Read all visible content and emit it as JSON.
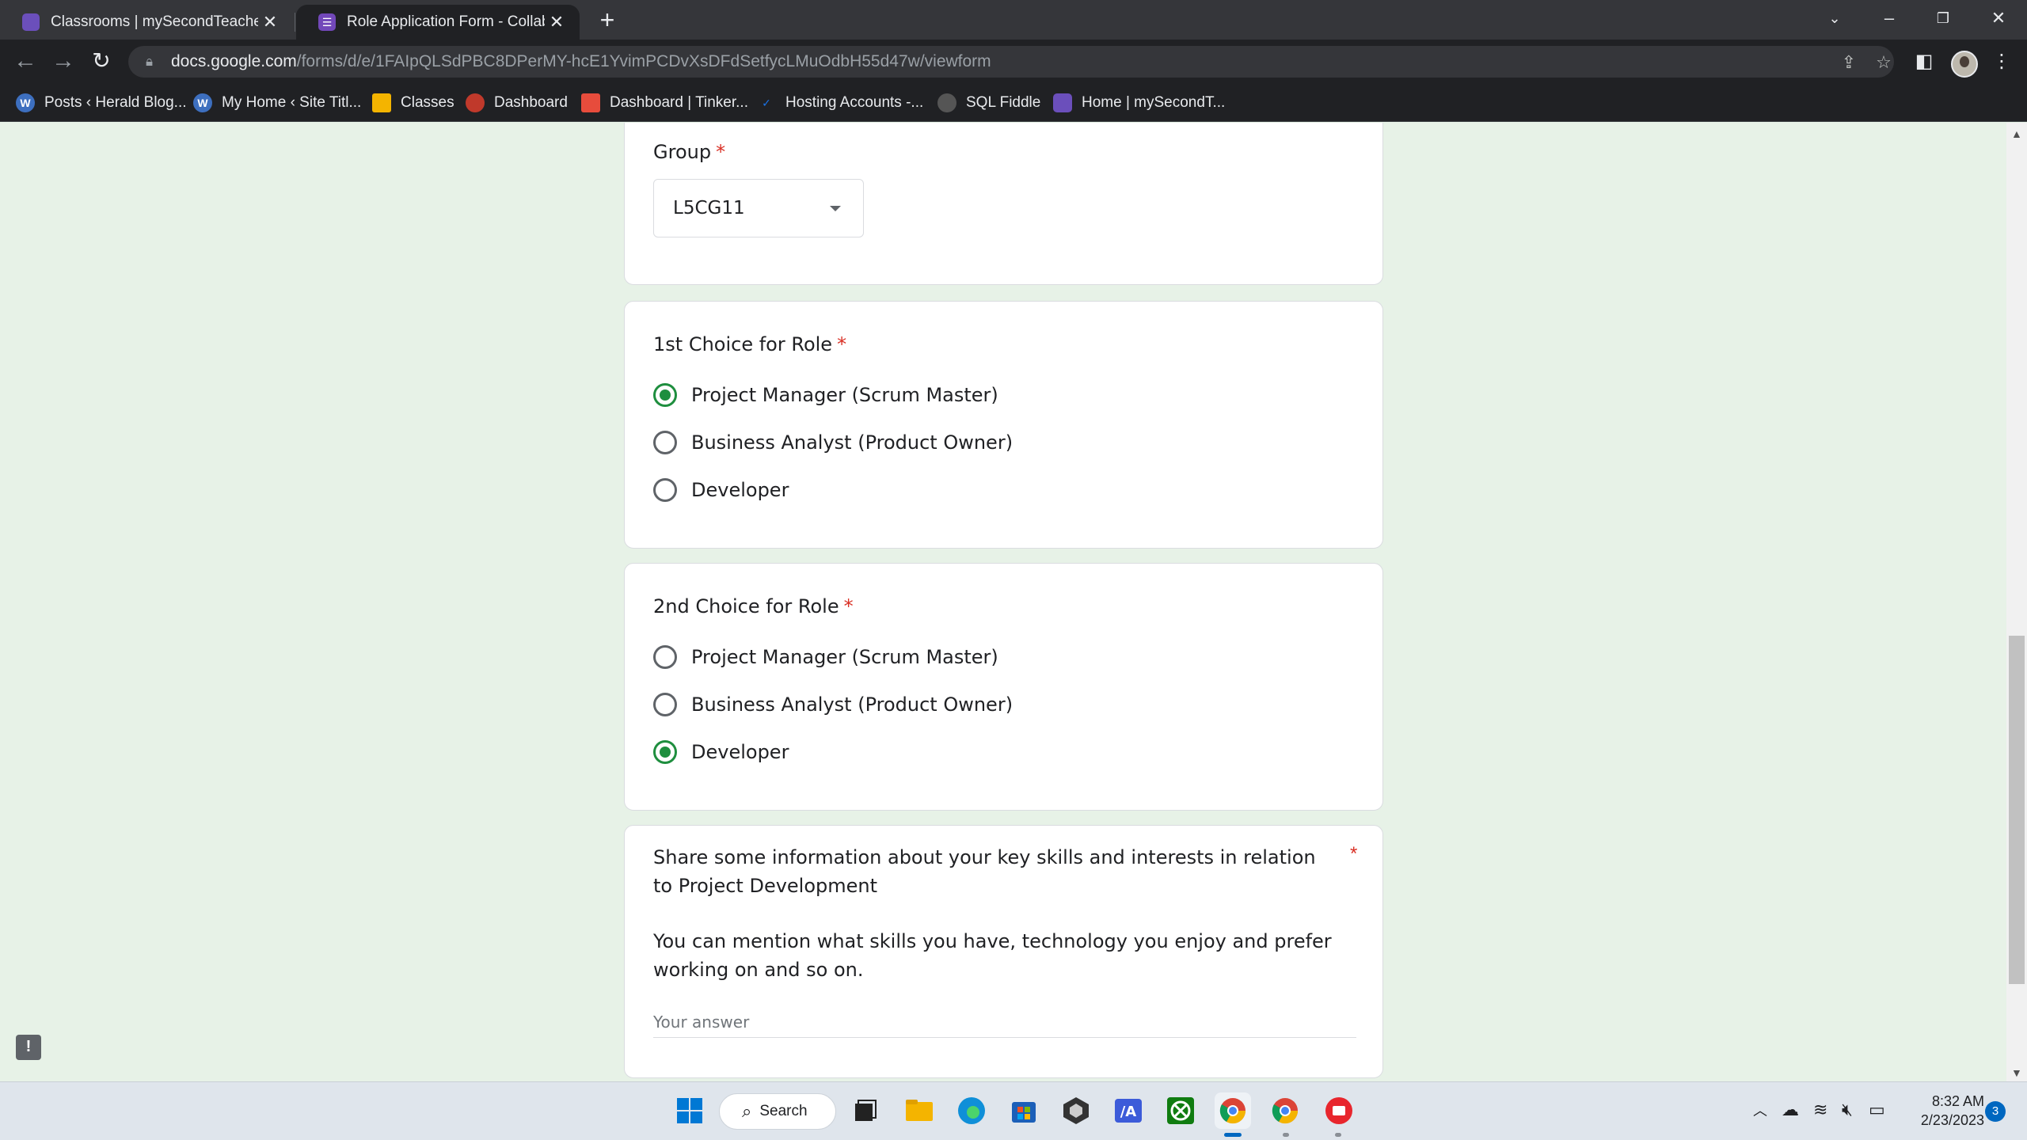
{
  "tabs": [
    {
      "title": "Classrooms | mySecondTeacher",
      "active": false
    },
    {
      "title": "Role Application Form - Collabor",
      "active": true
    }
  ],
  "address": {
    "host": "docs.google.com",
    "path": "/forms/d/e/1FAIpQLSdPBC8DPerMY-hcE1YvimPCDvXsDFdSetfycLMuOdbH55d47w/viewform"
  },
  "bookmarks": [
    {
      "label": "Posts ‹ Herald Blog...",
      "icon": "wordpress-icon",
      "color": "#3d6fbf"
    },
    {
      "label": "My Home ‹ Site Titl...",
      "icon": "wordpress-icon",
      "color": "#3d6fbf"
    },
    {
      "label": "Classes",
      "icon": "classroom-icon",
      "color": "#f4b400"
    },
    {
      "label": "Dashboard",
      "icon": "dashboard-icon",
      "color": "#c0392b"
    },
    {
      "label": "Dashboard | Tinker...",
      "icon": "tinkercad-icon",
      "color": "#e74c3c"
    },
    {
      "label": "Hosting Accounts -...",
      "icon": "hosting-icon",
      "color": "#1a73e8"
    },
    {
      "label": "SQL Fiddle",
      "icon": "sqlfiddle-icon",
      "color": "#777777"
    },
    {
      "label": "Home | mySecondT...",
      "icon": "mysecondteacher-icon",
      "color": "#6b4fbb"
    }
  ],
  "form": {
    "group": {
      "label": "Group",
      "required_mark": "*",
      "selected": "L5CG11"
    },
    "choice1": {
      "label": "1st Choice for Role",
      "required_mark": "*",
      "options": [
        {
          "label": "Project Manager (Scrum Master)",
          "checked": true
        },
        {
          "label": "Business Analyst (Product Owner)",
          "checked": false
        },
        {
          "label": "Developer",
          "checked": false
        }
      ]
    },
    "choice2": {
      "label": "2nd Choice for Role",
      "required_mark": "*",
      "options": [
        {
          "label": "Project Manager (Scrum Master)",
          "checked": false
        },
        {
          "label": "Business Analyst (Product Owner)",
          "checked": false
        },
        {
          "label": "Developer",
          "checked": true
        }
      ]
    },
    "skills": {
      "question": "Share some information about your key skills and interests in relation to Project Development",
      "description": "You can mention what skills you have, technology you enjoy and prefer working on and so on.",
      "required_mark": "*",
      "placeholder": "Your answer"
    }
  },
  "taskbar": {
    "search_label": "Search",
    "time": "8:32 AM",
    "date": "2/23/2023",
    "notifications": "3"
  },
  "colors": {
    "accent": "#1e8e3e",
    "page_bg": "#e7f2e7",
    "required": "#d93025"
  }
}
